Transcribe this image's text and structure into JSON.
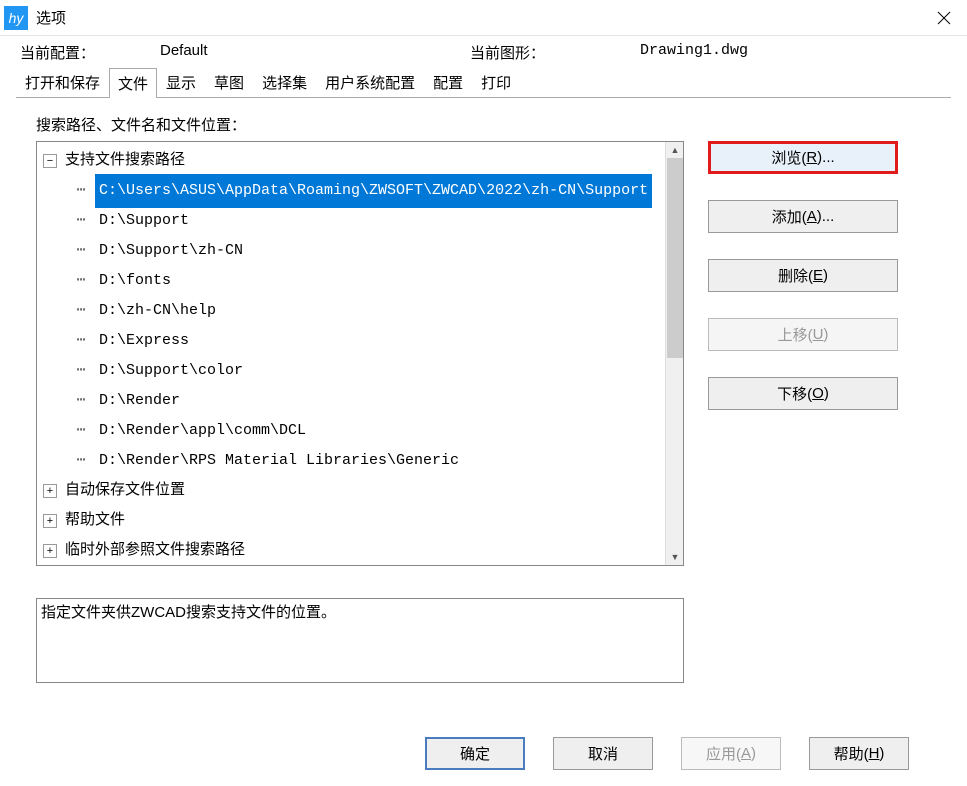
{
  "window": {
    "title": "选项",
    "icon_text": "hy"
  },
  "info": {
    "profile_label": "当前配置：",
    "profile_value": "Default",
    "drawing_label": "当前图形：",
    "drawing_value": "Drawing1.dwg"
  },
  "tabs": [
    {
      "label": "打开和保存",
      "active": false
    },
    {
      "label": "文件",
      "active": true
    },
    {
      "label": "显示",
      "active": false
    },
    {
      "label": "草图",
      "active": false
    },
    {
      "label": "选择集",
      "active": false
    },
    {
      "label": "用户系统配置",
      "active": false
    },
    {
      "label": "配置",
      "active": false
    },
    {
      "label": "打印",
      "active": false
    }
  ],
  "section_label": "搜索路径、文件名和文件位置：",
  "tree": {
    "top": {
      "label": "支持文件搜索路径",
      "expanded": true,
      "children": [
        {
          "path": "C:\\Users\\ASUS\\AppData\\Roaming\\ZWSOFT\\ZWCAD\\2022\\zh-CN\\Support",
          "selected": true
        },
        {
          "path": "D:\\Support",
          "selected": false
        },
        {
          "path": "D:\\Support\\zh-CN",
          "selected": false
        },
        {
          "path": "D:\\fonts",
          "selected": false
        },
        {
          "path": "D:\\zh-CN\\help",
          "selected": false
        },
        {
          "path": "D:\\Express",
          "selected": false
        },
        {
          "path": "D:\\Support\\color",
          "selected": false
        },
        {
          "path": "D:\\Render",
          "selected": false
        },
        {
          "path": "D:\\Render\\appl\\comm\\DCL",
          "selected": false
        },
        {
          "path": "D:\\Render\\RPS Material Libraries\\Generic",
          "selected": false
        }
      ]
    },
    "others": [
      {
        "label": "自动保存文件位置",
        "expanded": false
      },
      {
        "label": "帮助文件",
        "expanded": false
      },
      {
        "label": "临时外部参照文件搜索路径",
        "expanded": false
      }
    ]
  },
  "side_buttons": {
    "browse": {
      "text": "浏览(",
      "key": "R",
      "suffix": ")..."
    },
    "add": {
      "text": "添加(",
      "key": "A",
      "suffix": ")..."
    },
    "remove": {
      "text": "删除(",
      "key": "E",
      "suffix": ")"
    },
    "moveup": {
      "text": "上移(",
      "key": "U",
      "suffix": ")"
    },
    "movedown": {
      "text": "下移(",
      "key": "O",
      "suffix": ")"
    }
  },
  "description": "指定文件夹供ZWCAD搜索支持文件的位置。",
  "bottom_buttons": {
    "ok": "确定",
    "cancel": "取消",
    "apply": {
      "text": "应用(",
      "key": "A",
      "suffix": ")"
    },
    "help": {
      "text": "帮助(",
      "key": "H",
      "suffix": ")"
    }
  }
}
